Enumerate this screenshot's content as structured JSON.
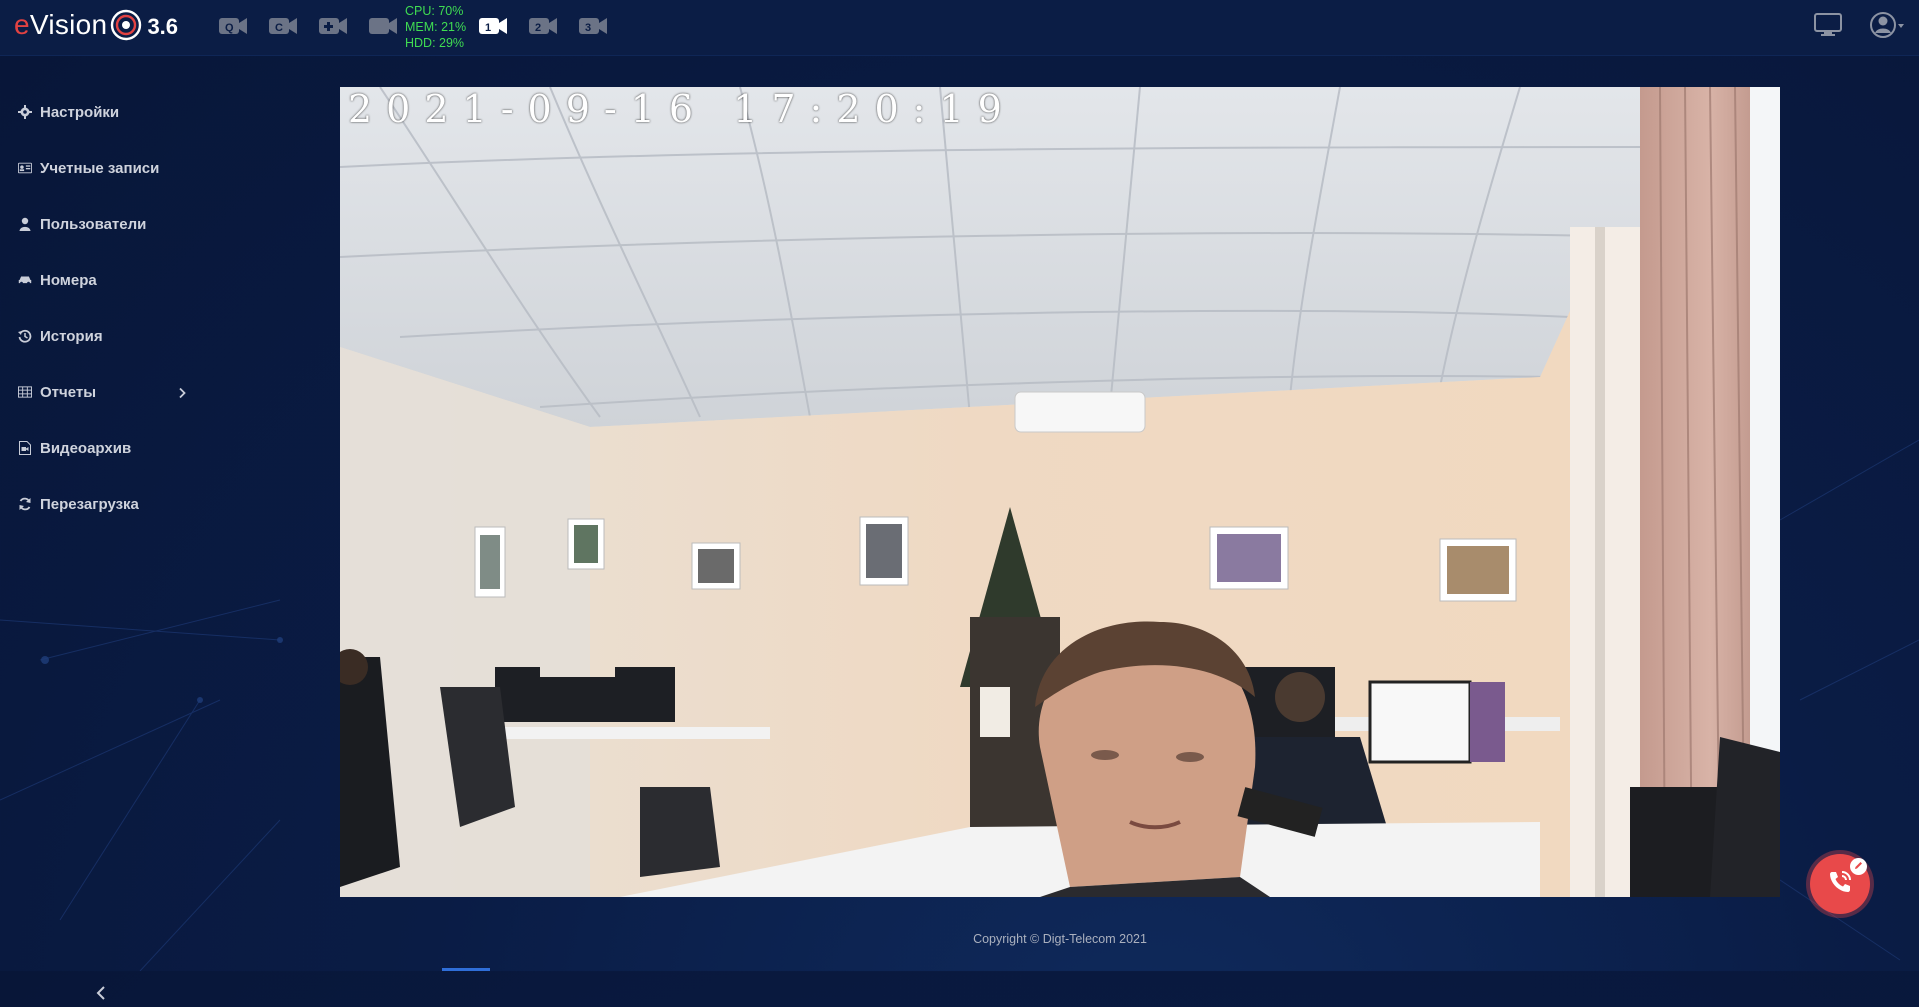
{
  "app": {
    "logo_text": "eVision",
    "version": "3.6"
  },
  "header": {
    "cam_icons_left": [
      "camera-q-icon",
      "camera-c-icon",
      "camera-plus-icon",
      "camera-icon"
    ],
    "cam_icons_right": [
      {
        "label": "1",
        "icon": "camera-1-icon",
        "active": true
      },
      {
        "label": "2",
        "icon": "camera-2-icon",
        "active": false
      },
      {
        "label": "3",
        "icon": "camera-3-icon",
        "active": false
      }
    ],
    "stats": {
      "cpu": "CPU: 70%",
      "mem": "MEM: 21%",
      "hdd": "HDD: 29%"
    },
    "right_icons": [
      "monitor-icon",
      "user-account-icon"
    ]
  },
  "sidebar": {
    "items": [
      {
        "label": "Настройки",
        "icon": "gear-icon"
      },
      {
        "label": "Учетные записи",
        "icon": "id-card-icon"
      },
      {
        "label": "Пользователи",
        "icon": "user-icon"
      },
      {
        "label": "Номера",
        "icon": "car-icon"
      },
      {
        "label": "История",
        "icon": "history-icon"
      },
      {
        "label": "Отчеты",
        "icon": "table-icon",
        "has_submenu": true
      },
      {
        "label": "Видеоархив",
        "icon": "video-file-icon"
      },
      {
        "label": "Перезагрузка",
        "icon": "refresh-icon"
      }
    ],
    "collapse_icon": "chevron-left-icon"
  },
  "video": {
    "timestamp": "2021-09-16 17:20:19",
    "lock_icon": "lock-icon"
  },
  "footer": {
    "copyright": "Copyright © Digt-Telecom 2021"
  },
  "fab": {
    "icon": "phone-call-icon",
    "badge_icon": "edit-pencil-icon"
  },
  "colors": {
    "background": "#0a1c45",
    "header": "#0b1d45",
    "stats_green": "#3fdc52",
    "fab_red": "#e8494a",
    "logo_accent": "#e24242"
  }
}
